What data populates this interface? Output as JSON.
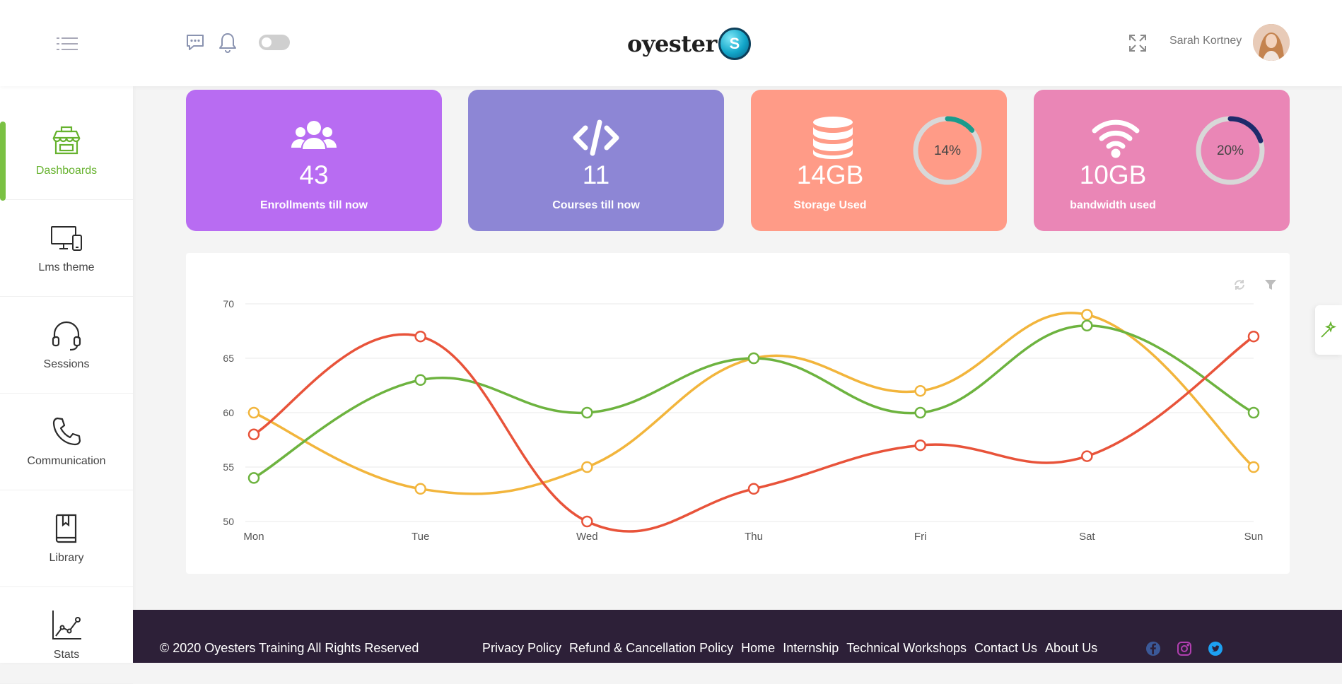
{
  "header": {
    "brand_text": "oyester",
    "brand_badge": "S",
    "user_name": "Sarah Kortney"
  },
  "sidebar": {
    "items": [
      {
        "label": "Dashboards",
        "icon": "store-icon",
        "active": true
      },
      {
        "label": "Lms theme",
        "icon": "devices-icon"
      },
      {
        "label": "Sessions",
        "icon": "headset-icon"
      },
      {
        "label": "Communication",
        "icon": "phone-icon"
      },
      {
        "label": "Library",
        "icon": "book-icon"
      },
      {
        "label": "Stats",
        "icon": "line-chart-icon"
      }
    ]
  },
  "cards": [
    {
      "value": "43",
      "caption": "Enrollments till now",
      "icon": "users-icon",
      "color": "#b86cf2"
    },
    {
      "value": "11",
      "caption": "Courses till now",
      "icon": "code-icon",
      "color": "#8d86d5"
    },
    {
      "value": "14GB",
      "caption": "Storage Used",
      "icon": "database-icon",
      "color": "#ff9b87",
      "percent_label": "14%",
      "percent": 14,
      "ring_color": "#1a9b8c"
    },
    {
      "value": "10GB",
      "caption": "bandwidth used",
      "icon": "wifi-icon",
      "color": "#ea86b6",
      "percent_label": "20%",
      "percent": 20,
      "ring_color": "#1e2a6b"
    }
  ],
  "chart_data": {
    "type": "line",
    "categories": [
      "Mon",
      "Tue",
      "Wed",
      "Thu",
      "Fri",
      "Sat",
      "Sun"
    ],
    "ylim": [
      50,
      70
    ],
    "yticks": [
      "70",
      "65",
      "60",
      "55",
      "50"
    ],
    "grid": true,
    "series": [
      {
        "color": "#e8533a",
        "values": [
          58,
          67,
          50,
          53,
          57,
          56,
          67
        ]
      },
      {
        "color": "#6db33f",
        "values": [
          54,
          63,
          60,
          65,
          60,
          68,
          60
        ]
      },
      {
        "color": "#f2b53c",
        "values": [
          60,
          53,
          55,
          65,
          62,
          69,
          55
        ]
      }
    ]
  },
  "footer": {
    "copyright": "© 2020 Oyesters Training All Rights Reserved",
    "links": [
      "Privacy Policy",
      "Refund & Cancellation Policy",
      "Home",
      "Internship",
      "Technical Workshops",
      "Contact Us",
      "About Us"
    ],
    "social_icons": [
      "facebook-icon",
      "instagram-icon",
      "twitter-icon"
    ],
    "social_colors": [
      "#3b5998",
      "#b13fb0",
      "#1da1f2"
    ]
  }
}
